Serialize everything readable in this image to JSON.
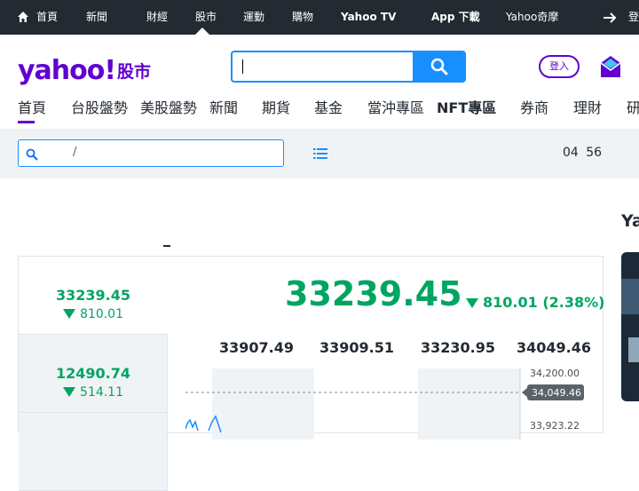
{
  "topnav": {
    "items": [
      "首頁",
      "新聞",
      "財經",
      "股市",
      "運動",
      "購物",
      "Yahoo TV",
      "App 下載",
      "Yahoo奇摩",
      "登入"
    ],
    "right_item": "Yahoo奇摩",
    "active_index": 3
  },
  "logo": {
    "brand": "yahoo!",
    "sub": "股市"
  },
  "login": {
    "label": "登入"
  },
  "secnav": {
    "items": [
      "首頁",
      "台股盤勢",
      "美股盤勢",
      "新聞",
      "期貨",
      "基金",
      "當沖專區",
      "NFT專區",
      "券商",
      "理財",
      "研究"
    ]
  },
  "quote_search": {
    "separator": "/"
  },
  "time": {
    "value": "04 56"
  },
  "right_rail": {
    "title": "Ya"
  },
  "indices": [
    {
      "value": "33239.45",
      "change": "810.01"
    },
    {
      "value": "12490.74",
      "change": "514.11"
    }
  ],
  "main_quote": {
    "price": "33239.45",
    "change": "810.01 (2.38%)",
    "stats": [
      "33907.49",
      "33909.51",
      "33230.95",
      "34049.46"
    ],
    "ticks": [
      "34,200.00",
      "34,049.46",
      "33,923.22"
    ]
  },
  "colors": {
    "up": "#00a562",
    "brand": "#6001d2",
    "accent": "#188fff",
    "nav_bg": "#232a31"
  },
  "chart_data": {
    "type": "line",
    "y_ticks": [
      "34,200.00",
      "33,923.22"
    ],
    "reference": "34,049.46",
    "values": []
  }
}
